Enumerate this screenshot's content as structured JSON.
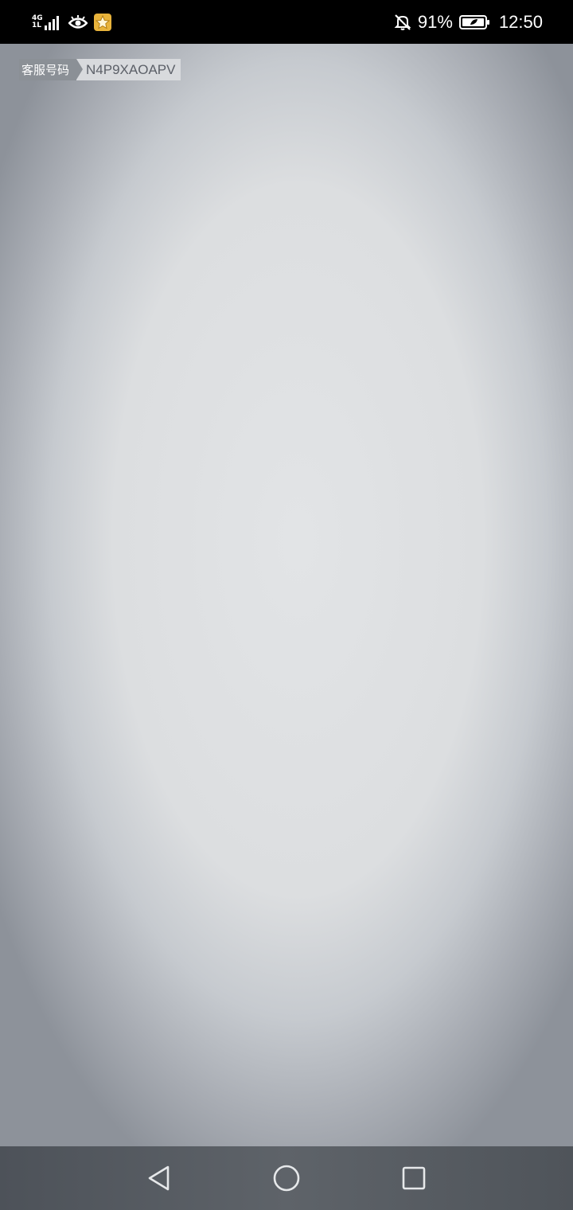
{
  "status_bar": {
    "network_type": "4G",
    "network_sub": "1L",
    "battery_percent": "91%",
    "time": "12:50",
    "icons": [
      "signal-icon",
      "eye-icon",
      "app-badge-icon",
      "mute-icon",
      "battery-icon"
    ]
  },
  "service_tag": {
    "label": "客服号码",
    "code": "N4P9XAOAPV"
  },
  "nav_bar": {
    "icons": [
      "back-icon",
      "home-icon",
      "recents-icon"
    ]
  },
  "colors": {
    "status_bar_bg": "#000000",
    "content_center": "#e2e4e6",
    "content_edge": "#8d929a",
    "tag_label_bg": "#8b9096",
    "tag_code_bg": "#d8dadd",
    "app_badge": "#e8b33b"
  }
}
